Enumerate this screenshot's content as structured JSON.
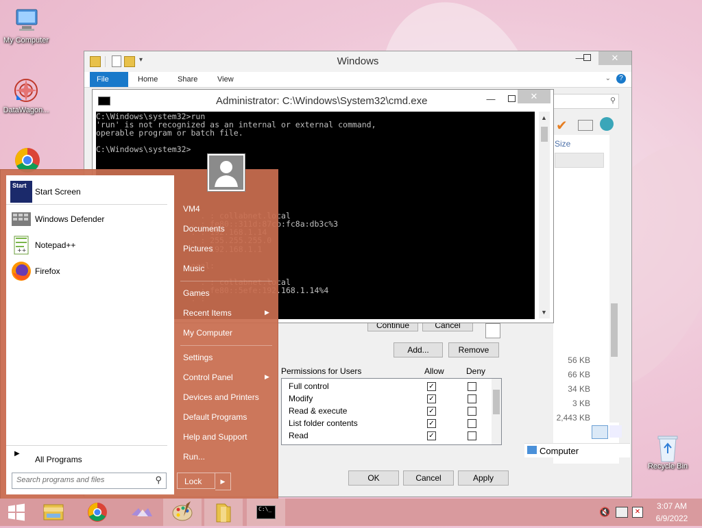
{
  "desktop": {
    "icons": [
      {
        "label": "My Computer"
      },
      {
        "label": "DataWagon..."
      },
      {
        "label": "Recycle Bin"
      }
    ]
  },
  "explorer": {
    "title": "Windows",
    "tabs": [
      "File",
      "Home",
      "Share",
      "View"
    ],
    "size_header": "Size",
    "sizes": [
      "56 KB",
      "66 KB",
      "34 KB",
      "3 KB",
      "2,443 KB"
    ],
    "partial_type": "nt",
    "status_location": "Computer"
  },
  "cmd": {
    "title": "Administrator: C:\\Windows\\System32\\cmd.exe",
    "lines": [
      "C:\\Windows\\system32>run",
      "'run' is not recognized as an internal or external command,",
      "operable program or batch file.",
      "",
      "C:\\Windows\\system32>",
      "",
      "",
      "",
      "",
      "",
      "",
      "",
      "                      . : collabnet.local",
      "                    . : fe80::311d:87cb:fc8a:db3c%3",
      "                    . : 192.168.1.14",
      "                    . : 255.255.255.0",
      "                    . : 192.168.1.1",
      "",
      "                    ocal:",
      "",
      "                      . : collabnet.local",
      "                    . : fe80::5efe:192.168.1.14%4",
      "                    . :"
    ],
    "partial_suffix": "g"
  },
  "start_menu": {
    "programs": [
      "Start Screen",
      "Windows Defender",
      "Notepad++",
      "Firefox"
    ],
    "all_programs": "All Programs",
    "search_placeholder": "Search programs and files",
    "right": {
      "user": "VM4",
      "items1": [
        "Documents",
        "Pictures",
        "Music",
        "Games",
        "Recent Items",
        "My Computer"
      ],
      "items2": [
        "Settings",
        "Control Panel",
        "Devices and Printers",
        "Default Programs",
        "Help and Support",
        "Run..."
      ]
    },
    "lock": "Lock",
    "start_icon_text": "Start"
  },
  "security": {
    "continue": "Continue",
    "cancel_top": "Cancel",
    "add": "Add...",
    "remove": "Remove",
    "permissions_for": "Permissions for Users",
    "allow": "Allow",
    "deny": "Deny",
    "rows": [
      {
        "name": "Full control",
        "allow": true,
        "deny": false
      },
      {
        "name": "Modify",
        "allow": true,
        "deny": false
      },
      {
        "name": "Read & execute",
        "allow": true,
        "deny": false
      },
      {
        "name": "List folder contents",
        "allow": true,
        "deny": false
      },
      {
        "name": "Read",
        "allow": true,
        "deny": false
      }
    ],
    "ok": "OK",
    "cancel": "Cancel",
    "apply": "Apply"
  },
  "taskbar": {
    "time": "3:07 AM",
    "date": "6/9/2022",
    "cmd_glyph": "C:\\_"
  },
  "colors": {
    "accent": "#1979ca",
    "start_menu_bg": "#c96e50",
    "taskbar_bg": "#d99a9e"
  }
}
